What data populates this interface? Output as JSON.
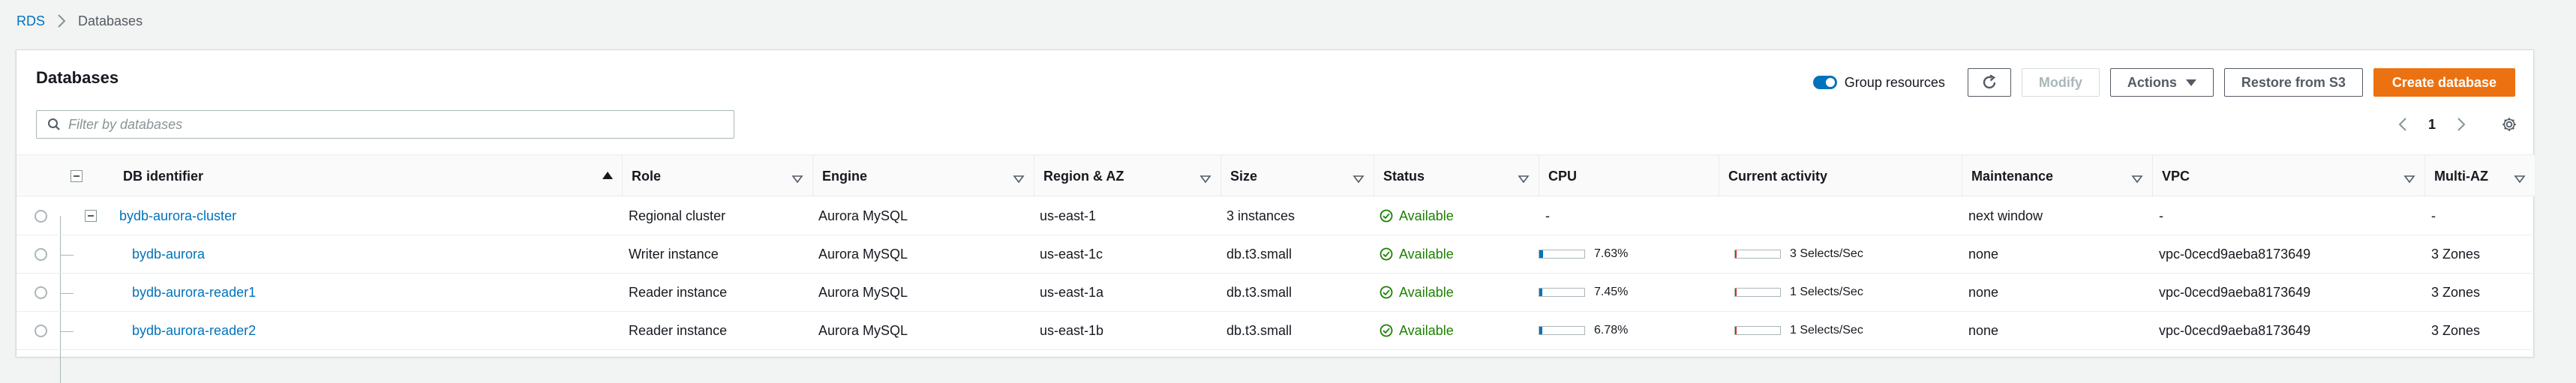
{
  "breadcrumb": {
    "root": "RDS",
    "current": "Databases"
  },
  "panel": {
    "title": "Databases"
  },
  "toolbar": {
    "group_resources_label": "Group resources",
    "group_resources_on": true,
    "modify_label": "Modify",
    "actions_label": "Actions",
    "restore_label": "Restore from S3",
    "create_label": "Create database"
  },
  "search": {
    "placeholder": "Filter by databases",
    "value": ""
  },
  "pager": {
    "page": "1"
  },
  "columns": {
    "db_identifier": "DB identifier",
    "role": "Role",
    "engine": "Engine",
    "region": "Region & AZ",
    "size": "Size",
    "status": "Status",
    "cpu": "CPU",
    "activity": "Current activity",
    "maintenance": "Maintenance",
    "vpc": "VPC",
    "multi_az": "Multi-AZ"
  },
  "rows": [
    {
      "id": "bydb-aurora-cluster",
      "role": "Regional cluster",
      "engine": "Aurora MySQL",
      "region": "us-east-1",
      "size": "3 instances",
      "status": "Available",
      "cpu": "-",
      "cpu_fraction": null,
      "activity": "",
      "activity_fraction": null,
      "maintenance": "next window",
      "vpc": "-",
      "multi_az": "-"
    },
    {
      "id": "bydb-aurora",
      "role": "Writer instance",
      "engine": "Aurora MySQL",
      "region": "us-east-1c",
      "size": "db.t3.small",
      "status": "Available",
      "cpu": "7.63%",
      "cpu_fraction": 0.0763,
      "activity": "3 Selects/Sec",
      "activity_fraction": 0.03,
      "maintenance": "none",
      "vpc": "vpc-0cecd9aeba8173649",
      "multi_az": "3 Zones"
    },
    {
      "id": "bydb-aurora-reader1",
      "role": "Reader instance",
      "engine": "Aurora MySQL",
      "region": "us-east-1a",
      "size": "db.t3.small",
      "status": "Available",
      "cpu": "7.45%",
      "cpu_fraction": 0.0745,
      "activity": "1 Selects/Sec",
      "activity_fraction": 0.03,
      "maintenance": "none",
      "vpc": "vpc-0cecd9aeba8173649",
      "multi_az": "3 Zones"
    },
    {
      "id": "bydb-aurora-reader2",
      "role": "Reader instance",
      "engine": "Aurora MySQL",
      "region": "us-east-1b",
      "size": "db.t3.small",
      "status": "Available",
      "cpu": "6.78%",
      "cpu_fraction": 0.0678,
      "activity": "1 Selects/Sec",
      "activity_fraction": 0.03,
      "maintenance": "none",
      "vpc": "vpc-0cecd9aeba8173649",
      "multi_az": "3 Zones"
    }
  ],
  "colors": {
    "link": "#0073bb",
    "primary": "#ec7211",
    "success": "#1d8102",
    "activity_bar": "#d13212"
  }
}
